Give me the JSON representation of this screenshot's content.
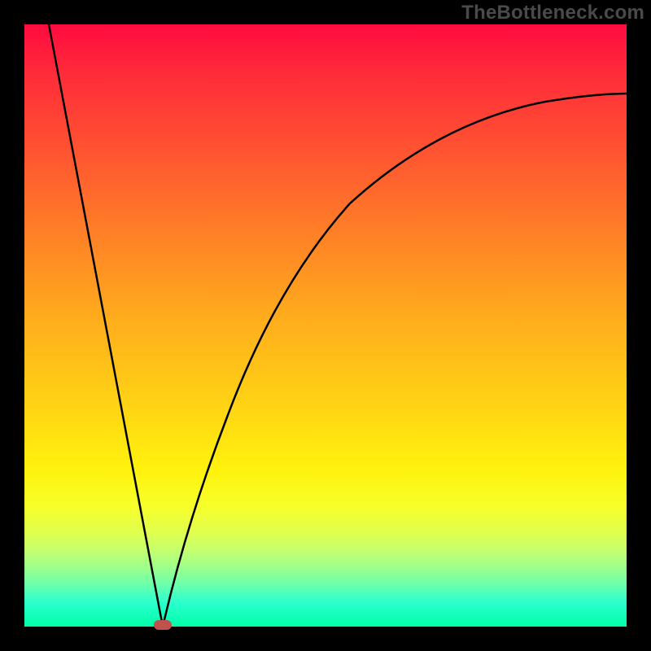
{
  "watermark": "TheBottleneck.com",
  "chart_data": {
    "type": "line",
    "title": "",
    "xlabel": "",
    "ylabel": "",
    "xlim": [
      0,
      100
    ],
    "ylim": [
      0,
      100
    ],
    "grid": false,
    "legend": false,
    "series": [
      {
        "name": "left-branch",
        "x": [
          4,
          8,
          12,
          16,
          20,
          23
        ],
        "values": [
          100,
          79,
          58,
          37,
          16,
          0
        ]
      },
      {
        "name": "right-branch",
        "x": [
          23,
          26,
          30,
          35,
          40,
          50,
          60,
          70,
          80,
          90,
          100
        ],
        "values": [
          0,
          14,
          30,
          44,
          55,
          69,
          77,
          82,
          85,
          87,
          88
        ]
      }
    ],
    "marker": {
      "name": "optimal-point",
      "x": 23,
      "y": 0,
      "color": "#c0524e"
    },
    "background_gradient": {
      "top": "#ff0b3f",
      "bottom": "#00ffa8"
    }
  }
}
